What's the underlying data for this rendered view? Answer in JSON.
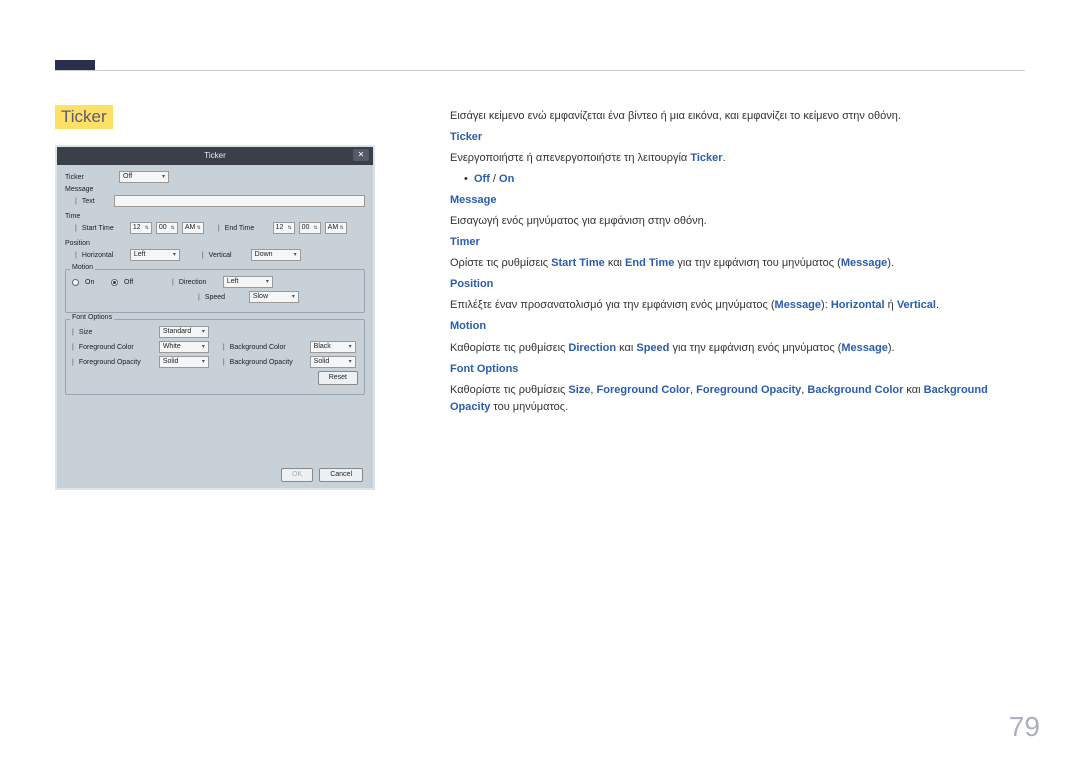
{
  "section_title": "Ticker",
  "page_number": "79",
  "dialog": {
    "title": "Ticker",
    "close": "✕",
    "ticker_label": "Ticker",
    "ticker_value": "Off",
    "message_label": "Message",
    "message_indent": "Text",
    "time_label": "Time",
    "start_time_label": "Start Time",
    "start_h": "12",
    "start_m": "00",
    "start_ampm": "AM",
    "end_time_label": "End Time",
    "end_h": "12",
    "end_m": "00",
    "end_ampm": "AM",
    "position_label": "Position",
    "horizontal_label": "Horizontal",
    "horizontal_value": "Left",
    "vertical_label": "Vertical",
    "vertical_value": "Down",
    "motion_label": "Motion",
    "on_label": "On",
    "off_label": "Off",
    "direction_label": "Direction",
    "direction_value": "Left",
    "speed_label": "Speed",
    "speed_value": "Slow",
    "font_options_label": "Font Options",
    "size_label": "Size",
    "size_value": "Standard",
    "fg_color_label": "Foreground Color",
    "fg_color_value": "White",
    "bg_color_label": "Background Color",
    "bg_color_value": "Black",
    "fg_opacity_label": "Foreground Opacity",
    "fg_opacity_value": "Solid",
    "bg_opacity_label": "Background Opacity",
    "bg_opacity_value": "Solid",
    "reset": "Reset",
    "ok": "OK",
    "cancel": "Cancel"
  },
  "desc": {
    "intro": "Εισάγει κείμενο ενώ εμφανίζεται ένα βίντεο ή μια εικόνα, και εμφανίζει το κείμενο στην οθόνη.",
    "ticker_h": "Ticker",
    "ticker_t1": "Ενεργοποιήστε ή απενεργοποιήστε τη λειτουργία ",
    "ticker_bold": "Ticker",
    "off": "Off",
    "slash": " / ",
    "on": "On",
    "message_h": "Message",
    "message_t": "Εισαγωγή ενός μηνύματος για εμφάνιση στην οθόνη.",
    "timer_h": "Timer",
    "timer_t1": "Ορίστε τις ρυθμίσεις ",
    "start_time": "Start Time",
    "kai": " και ",
    "end_time": "End Time",
    "timer_t2": " για την εμφάνιση του μηνύματος (",
    "msg": "Message",
    "close_paren": ").",
    "position_h": "Position",
    "position_t1": "Επιλέξτε έναν προσανατολισμό για την εμφάνιση ενός μηνύματος (",
    "position_sep": "): ",
    "horizontal": "Horizontal",
    "h_or": " ή ",
    "vertical": "Vertical",
    "period": ".",
    "motion_h": "Motion",
    "motion_t1": "Καθορίστε τις ρυθμίσεις ",
    "direction": "Direction",
    "speed": "Speed",
    "motion_t2": " για την εμφάνιση ενός μηνύματος (",
    "font_h": "Font Options",
    "font_t1": "Καθορίστε τις ρυθμίσεις ",
    "size": "Size",
    "comma": ", ",
    "fgc": "Foreground Color",
    "fgo": "Foreground Opacity",
    "bgc": "Background Color",
    "font_kai": " και ",
    "bgo": "Background Opacity",
    "font_end": " του μηνύματος."
  }
}
